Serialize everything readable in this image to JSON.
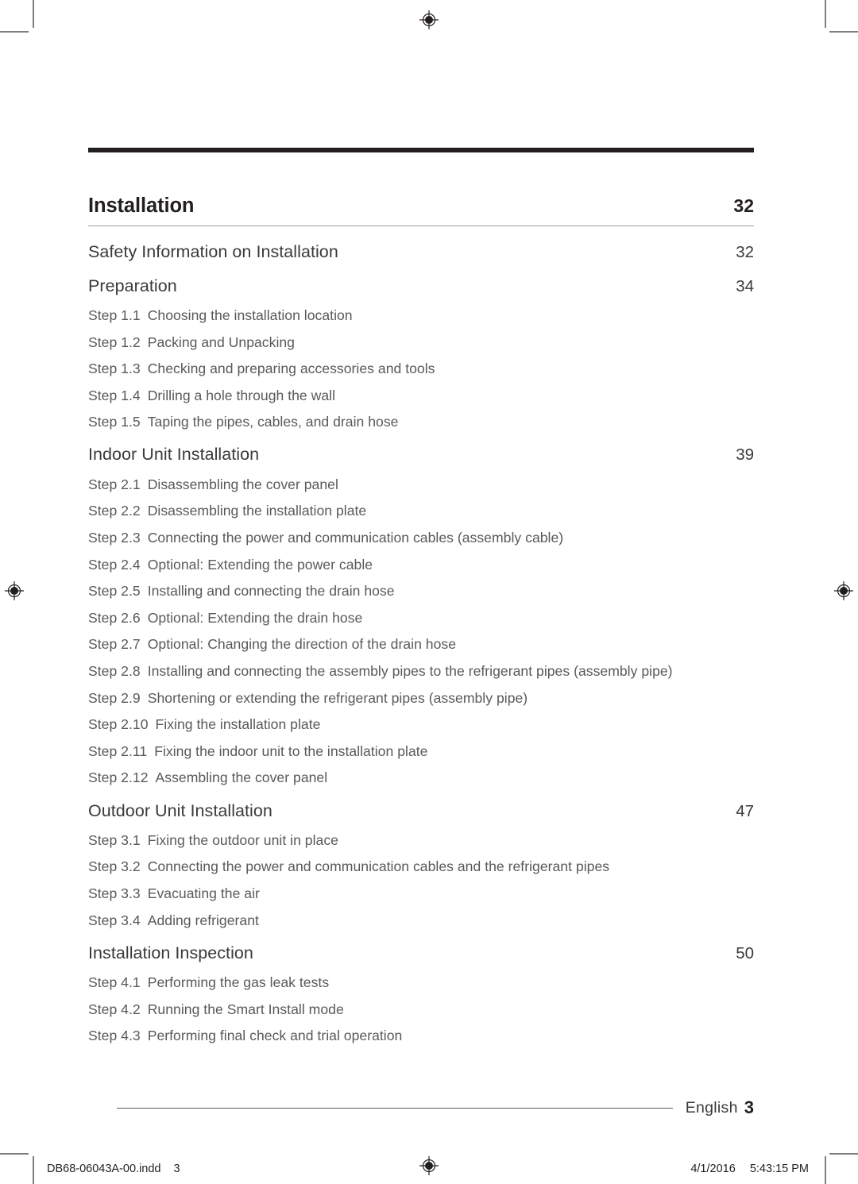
{
  "document": {
    "top_rule": true,
    "chapter": {
      "title": "Installation",
      "page": "32"
    },
    "sections": [
      {
        "title": "Safety Information on Installation",
        "page": "32",
        "steps": []
      },
      {
        "title": "Preparation",
        "page": "34",
        "steps": [
          {
            "label": "Step 1.1",
            "text": "Choosing the installation location"
          },
          {
            "label": "Step 1.2",
            "text": "Packing and Unpacking"
          },
          {
            "label": "Step 1.3",
            "text": "Checking and preparing accessories and tools"
          },
          {
            "label": "Step 1.4",
            "text": "Drilling a hole through the wall"
          },
          {
            "label": "Step 1.5",
            "text": "Taping the pipes, cables, and drain hose"
          }
        ]
      },
      {
        "title": "Indoor Unit Installation",
        "page": "39",
        "steps": [
          {
            "label": "Step 2.1",
            "text": "Disassembling the cover panel"
          },
          {
            "label": "Step 2.2",
            "text": "Disassembling the installation plate"
          },
          {
            "label": "Step 2.3",
            "text": "Connecting the power and communication cables (assembly cable)"
          },
          {
            "label": "Step 2.4",
            "text": "Optional: Extending the power cable"
          },
          {
            "label": "Step 2.5",
            "text": "Installing and connecting the drain hose"
          },
          {
            "label": "Step 2.6",
            "text": "Optional: Extending the drain hose"
          },
          {
            "label": "Step 2.7",
            "text": "Optional: Changing the direction of the drain hose"
          },
          {
            "label": "Step 2.8",
            "text": "Installing and connecting the assembly pipes to the refrigerant pipes (assembly pipe)"
          },
          {
            "label": "Step 2.9",
            "text": "Shortening or extending the refrigerant pipes (assembly pipe)"
          },
          {
            "label": "Step 2.10",
            "text": "Fixing the installation plate"
          },
          {
            "label": "Step 2.11",
            "text": "Fixing the indoor unit to the installation plate"
          },
          {
            "label": "Step 2.12",
            "text": "Assembling the cover panel"
          }
        ]
      },
      {
        "title": "Outdoor Unit Installation",
        "page": "47",
        "steps": [
          {
            "label": "Step 3.1",
            "text": "Fixing the outdoor unit in place"
          },
          {
            "label": "Step 3.2",
            "text": "Connecting the power and communication cables and the refrigerant pipes"
          },
          {
            "label": "Step 3.3",
            "text": "Evacuating the air"
          },
          {
            "label": "Step 3.4",
            "text": "Adding refrigerant"
          }
        ]
      },
      {
        "title": "Installation Inspection",
        "page": "50",
        "steps": [
          {
            "label": "Step 4.1",
            "text": "Performing the gas leak tests"
          },
          {
            "label": "Step 4.2",
            "text": "Running the Smart Install mode"
          },
          {
            "label": "Step 4.3",
            "text": "Performing final check and trial operation"
          }
        ]
      }
    ],
    "footer": {
      "language": "English",
      "page_number": "3"
    },
    "slug": {
      "file_name": "DB68-06043A-00.indd",
      "file_page": "3",
      "date": "4/1/2016",
      "time": "5:43:15 PM"
    }
  },
  "colors": {
    "rule_dark": "#231f20",
    "rule_light": "#9a9a9a",
    "text_primary": "#231f20",
    "text_secondary": "#3a3a3a",
    "text_tertiary": "#58595b"
  }
}
